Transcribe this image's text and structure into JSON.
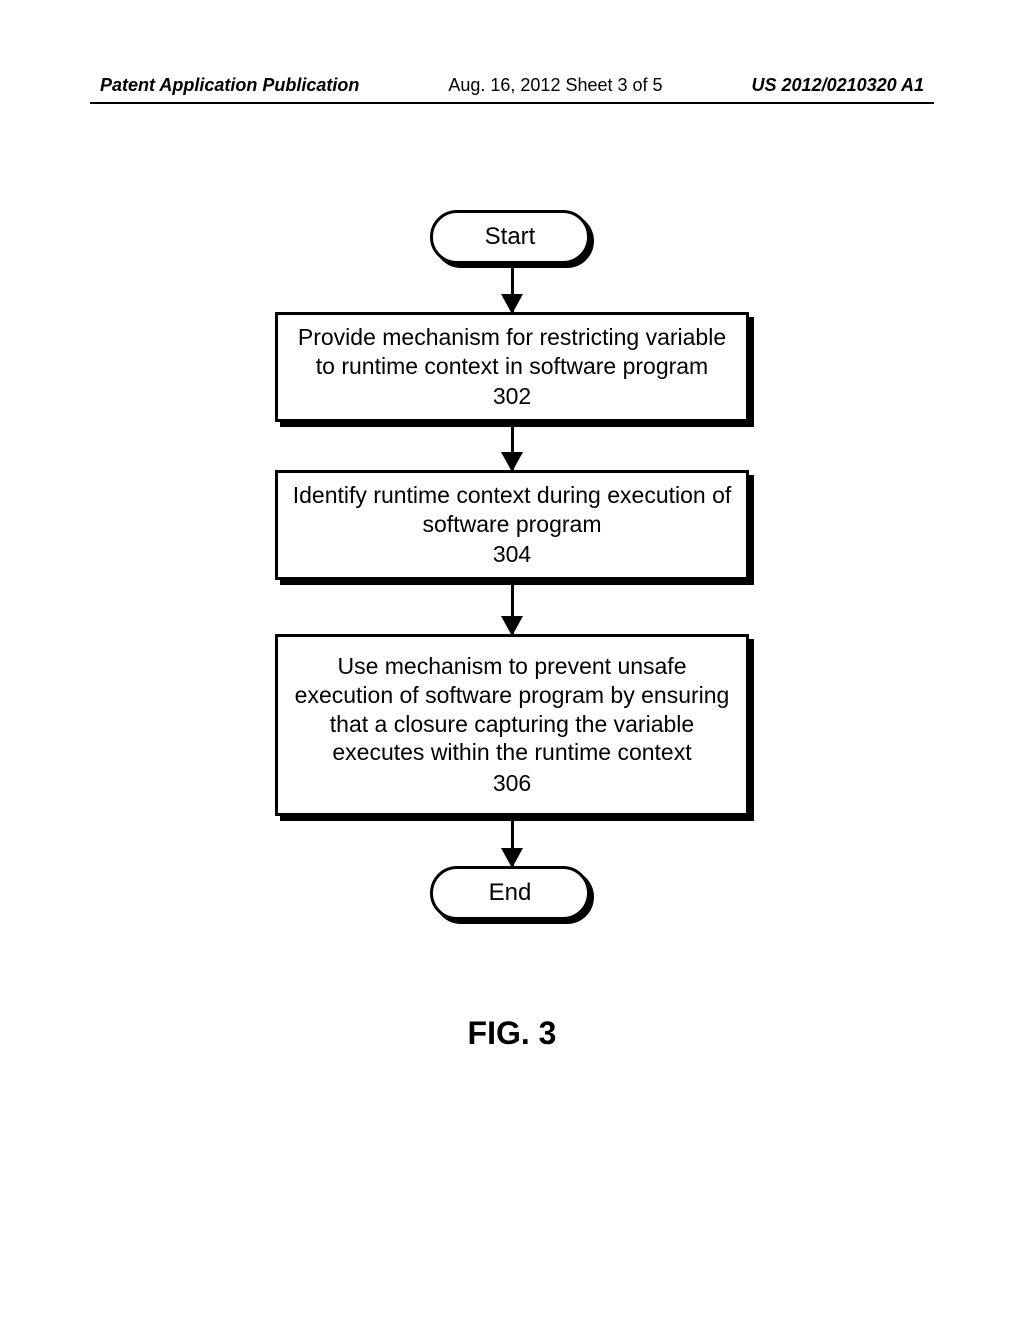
{
  "header": {
    "left": "Patent Application Publication",
    "center": "Aug. 16, 2012 Sheet 3 of 5",
    "right": "US 2012/0210320 A1"
  },
  "flowchart": {
    "start": "Start",
    "steps": [
      {
        "text": "Provide mechanism for restricting variable to runtime context in software program",
        "num": "302"
      },
      {
        "text": "Identify runtime context during execution of software program",
        "num": "304"
      },
      {
        "text": "Use mechanism to prevent unsafe execution of software program by ensuring that a closure capturing the variable executes within the runtime context",
        "num": "306"
      }
    ],
    "end": "End"
  },
  "figure_label": "FIG. 3"
}
